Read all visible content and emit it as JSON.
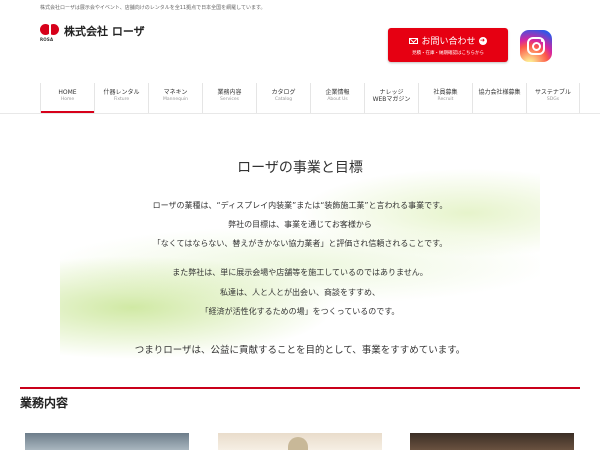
{
  "topbar": {
    "text": "株式会社ローザは展示会やイベント、店舗向けのレンタルを全11拠点で日本全国を網羅しています。"
  },
  "logo": {
    "sub": "ROSA",
    "name": "株式会社 ローザ"
  },
  "contact": {
    "label": "お問い合わせ",
    "sub": "見積・在庫・納期確認はこちらから",
    "arrow": "➜"
  },
  "nav": [
    {
      "jp": "HOME",
      "en": "Home"
    },
    {
      "jp": "什器レンタル",
      "en": "Fixture"
    },
    {
      "jp": "マネキン",
      "en": "Mannequin"
    },
    {
      "jp": "業務内容",
      "en": "Services"
    },
    {
      "jp": "カタログ",
      "en": "Catalog"
    },
    {
      "jp": "企業情報",
      "en": "About Us"
    },
    {
      "jp": "ナレッジ",
      "jp2": "WEBマガジン"
    },
    {
      "jp": "社員募集",
      "en": "Recruit"
    },
    {
      "jp": "協力会社様募集",
      "en": ""
    },
    {
      "jp": "サステナブル",
      "en": "SDGs"
    }
  ],
  "hero": {
    "title": "ローザの事業と目標",
    "lines": [
      "ローザの業種は、“ディスプレイ内装業”または“装飾施工業”と言われる事業です。",
      "弊社の目標は、事業を通じてお客様から",
      "「なくてはならない、替えがきかない協力業者」と評価され信頼されることです。",
      "また弊社は、単に展示会場や店舗等を施工しているのではありません。",
      "私達は、人と人とが出会い、商談をすすめ、",
      "「経済が活性化するための場」をつくっているのです。",
      "つまりローザは、公益に貢献することを目的として、事業をすすめています。"
    ]
  },
  "section": {
    "title": "業務内容"
  }
}
